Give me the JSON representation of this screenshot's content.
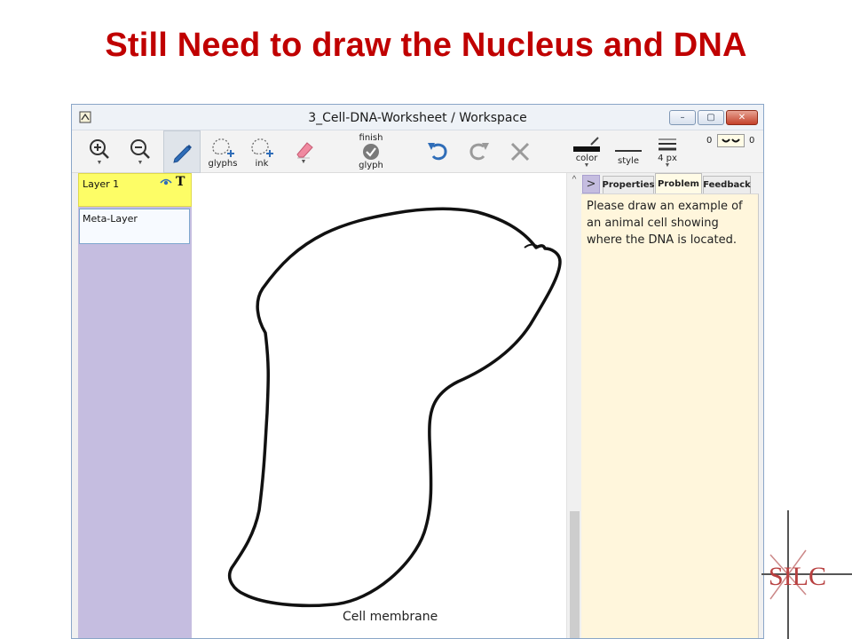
{
  "slide": {
    "title": "Still Need to draw the Nucleus and DNA"
  },
  "window": {
    "title": "3_Cell-DNA-Worksheet / Workspace",
    "buttons": {
      "minimize": "–",
      "maximize": "▢",
      "close": "✕"
    }
  },
  "toolbar": {
    "glyphs_label": "glyphs",
    "ink_label": "ink",
    "finish_top": "finish",
    "finish_bottom": "glyph",
    "color_label": "color",
    "style_label": "style",
    "width_label": "4 px",
    "slider_min": "0",
    "slider_max": "0"
  },
  "layers": {
    "items": [
      {
        "label": "Layer 1"
      },
      {
        "label": "Meta-Layer"
      }
    ]
  },
  "canvas": {
    "caption": "Cell membrane"
  },
  "right_panel": {
    "tabs": [
      "Properties",
      "Problem",
      "Feedback"
    ],
    "active_tab": "Problem",
    "problem_text": "Please draw an example of an animal cell showing where the DNA is located."
  },
  "logo": {
    "text": "SILC"
  },
  "colors": {
    "title": "#c00000",
    "layer_active": "#fdfd66",
    "layer_panel": "#c5bde0",
    "problem_bg": "#fff6dc"
  }
}
